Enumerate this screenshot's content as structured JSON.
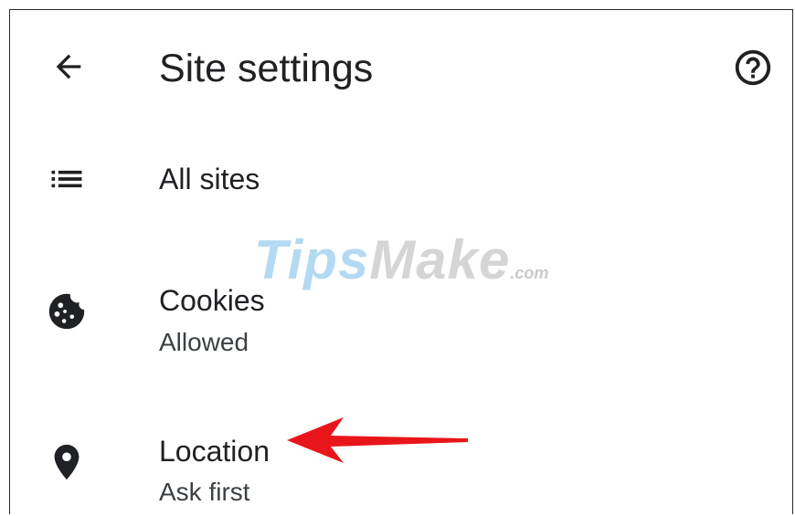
{
  "toolbar": {
    "title": "Site settings",
    "back_icon": "arrow-back-icon",
    "help_icon": "help-circle-icon"
  },
  "items": [
    {
      "label": "All sites",
      "icon": "list-icon"
    },
    {
      "label": "Cookies",
      "subtitle": "Allowed",
      "icon": "cookie-icon"
    },
    {
      "label": "Location",
      "subtitle": "Ask first",
      "icon": "location-pin-icon"
    }
  ],
  "watermark": {
    "brand_part1": "Tips",
    "brand_part2": "Make",
    "domain": ".com"
  },
  "colors": {
    "text": "#202124",
    "annotation_arrow": "#e8161b"
  }
}
